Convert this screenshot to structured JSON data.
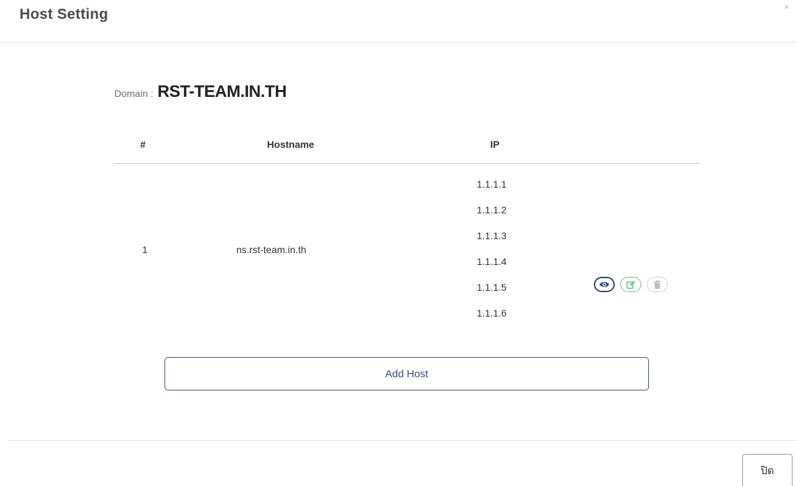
{
  "modal": {
    "title": "Host Setting",
    "close_symbol": "×"
  },
  "domain": {
    "label": "Domain : ",
    "value": "RST-TEAM.IN.TH"
  },
  "table": {
    "headers": {
      "index": "#",
      "hostname": "Hostname",
      "ip": "IP"
    },
    "rows": [
      {
        "index": "1",
        "hostname": "ns.rst-team.in.th",
        "ips": [
          "1.1.1.1",
          "1.1.1.2",
          "1.1.1.3",
          "1.1.1.4",
          "1.1.1.5",
          "1.1.1.6"
        ],
        "actions": [
          {
            "icon": "eye-icon",
            "color": "#2f4a7c"
          },
          {
            "icon": "edit-icon",
            "color": "#5bc48a"
          },
          {
            "icon": "trash-icon",
            "color": "#bdbdbd"
          }
        ]
      }
    ]
  },
  "buttons": {
    "add_host": "Add Host",
    "close": "ปิด"
  }
}
